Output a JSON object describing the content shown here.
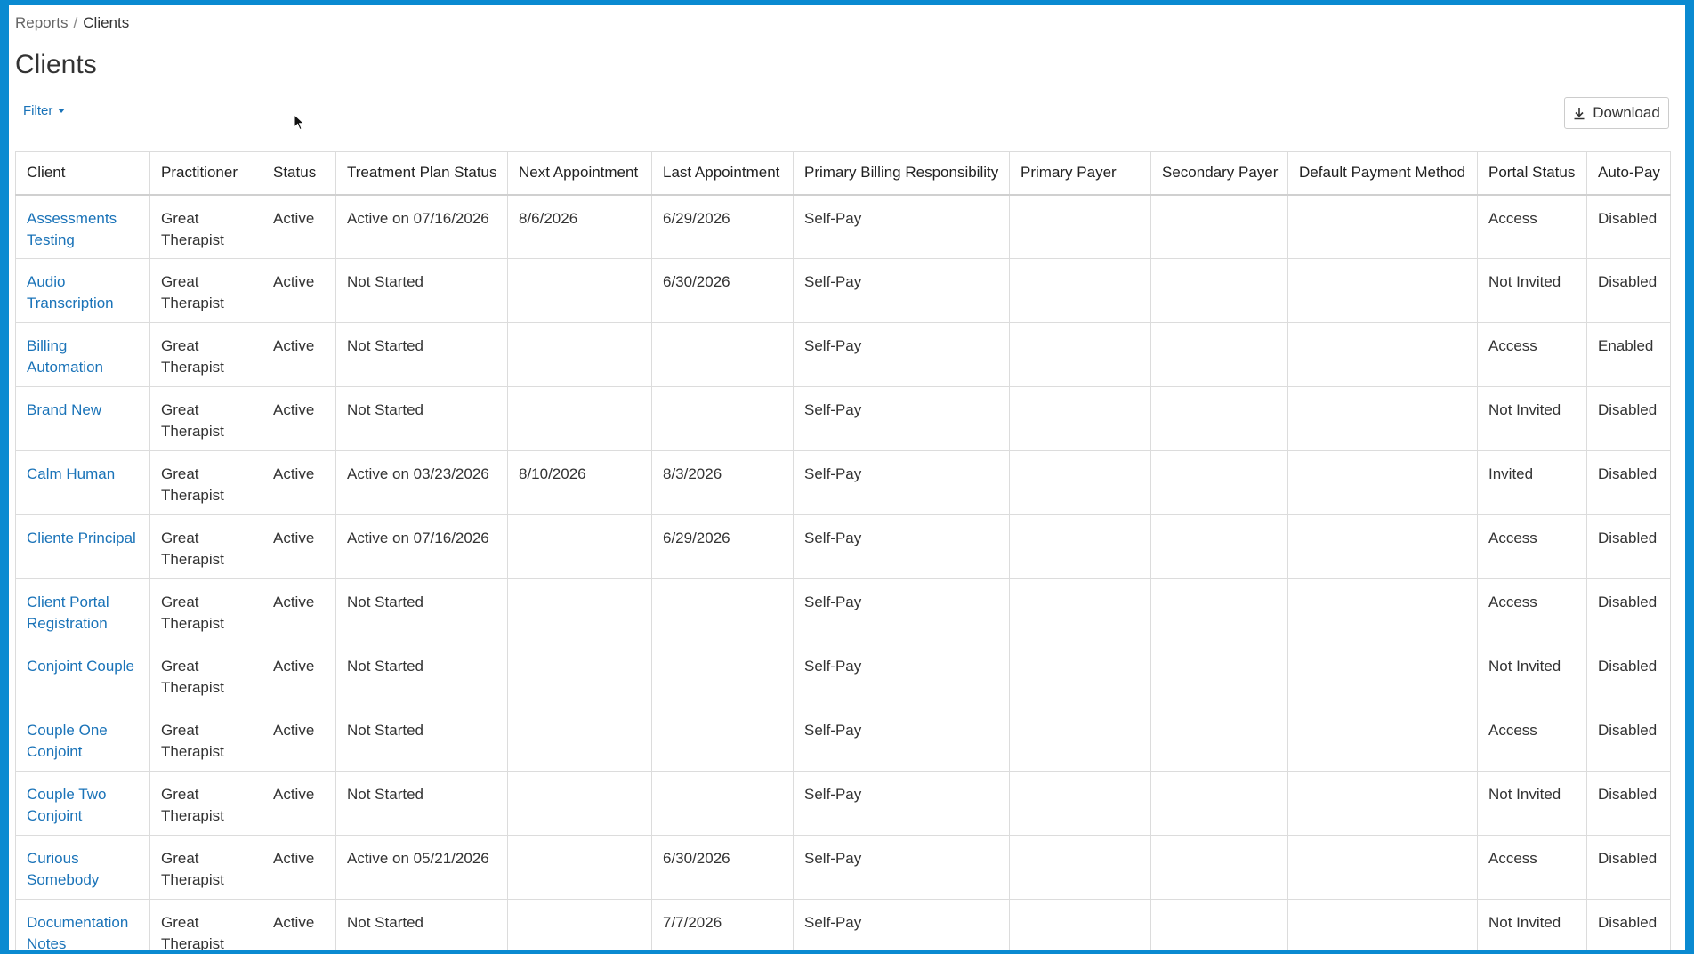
{
  "breadcrumb": {
    "parent": "Reports",
    "separator": "/",
    "current": "Clients"
  },
  "page_title": "Clients",
  "filter_label": "Filter",
  "download_label": "Download",
  "colors": {
    "accent": "#0a8ad1",
    "link": "#1a73b8"
  },
  "table": {
    "columns": [
      "Client",
      "Practitioner",
      "Status",
      "Treatment Plan Status",
      "Next Appointment",
      "Last Appointment",
      "Primary Billing Responsibility",
      "Primary Payer",
      "Secondary Payer",
      "Default Payment Method",
      "Portal Status",
      "Auto-Pay"
    ],
    "rows": [
      [
        "Assessments Testing",
        "Great Therapist",
        "Active",
        "Active on 07/16/2026",
        "8/6/2026",
        "6/29/2026",
        "Self-Pay",
        "",
        "",
        "",
        "Access",
        "Disabled"
      ],
      [
        "Audio Transcription",
        "Great Therapist",
        "Active",
        "Not Started",
        "",
        "6/30/2026",
        "Self-Pay",
        "",
        "",
        "",
        "Not Invited",
        "Disabled"
      ],
      [
        "Billing Automation",
        "Great Therapist",
        "Active",
        "Not Started",
        "",
        "",
        "Self-Pay",
        "",
        "",
        "",
        "Access",
        "Enabled"
      ],
      [
        "Brand New",
        "Great Therapist",
        "Active",
        "Not Started",
        "",
        "",
        "Self-Pay",
        "",
        "",
        "",
        "Not Invited",
        "Disabled"
      ],
      [
        "Calm Human",
        "Great Therapist",
        "Active",
        "Active on 03/23/2026",
        "8/10/2026",
        "8/3/2026",
        "Self-Pay",
        "",
        "",
        "",
        "Invited",
        "Disabled"
      ],
      [
        "Cliente Principal",
        "Great Therapist",
        "Active",
        "Active on 07/16/2026",
        "",
        "6/29/2026",
        "Self-Pay",
        "",
        "",
        "",
        "Access",
        "Disabled"
      ],
      [
        "Client Portal Registration",
        "Great Therapist",
        "Active",
        "Not Started",
        "",
        "",
        "Self-Pay",
        "",
        "",
        "",
        "Access",
        "Disabled"
      ],
      [
        "Conjoint Couple",
        "Great Therapist",
        "Active",
        "Not Started",
        "",
        "",
        "Self-Pay",
        "",
        "",
        "",
        "Not Invited",
        "Disabled"
      ],
      [
        "Couple One Conjoint",
        "Great Therapist",
        "Active",
        "Not Started",
        "",
        "",
        "Self-Pay",
        "",
        "",
        "",
        "Access",
        "Disabled"
      ],
      [
        "Couple Two Conjoint",
        "Great Therapist",
        "Active",
        "Not Started",
        "",
        "",
        "Self-Pay",
        "",
        "",
        "",
        "Not Invited",
        "Disabled"
      ],
      [
        "Curious Somebody",
        "Great Therapist",
        "Active",
        "Active on 05/21/2026",
        "",
        "6/30/2026",
        "Self-Pay",
        "",
        "",
        "",
        "Access",
        "Disabled"
      ],
      [
        "Documentation Notes",
        "Great Therapist",
        "Active",
        "Not Started",
        "",
        "7/7/2026",
        "Self-Pay",
        "",
        "",
        "",
        "Not Invited",
        "Disabled"
      ]
    ]
  }
}
